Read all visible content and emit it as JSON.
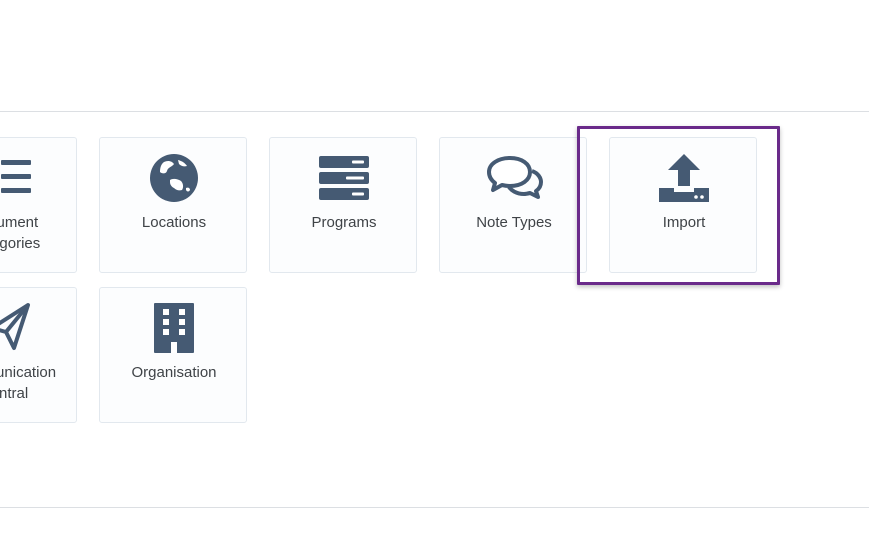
{
  "tiles": [
    {
      "id": "document-categories",
      "label": "Document\nCategories",
      "icon": "list-icon"
    },
    {
      "id": "locations",
      "label": "Locations",
      "icon": "globe-icon"
    },
    {
      "id": "programs",
      "label": "Programs",
      "icon": "server-icon"
    },
    {
      "id": "note-types",
      "label": "Note Types",
      "icon": "comments-icon"
    },
    {
      "id": "import",
      "label": "Import",
      "icon": "upload-icon"
    },
    {
      "id": "communication-central",
      "label": "Communication\nCentral",
      "icon": "paper-plane-icon"
    },
    {
      "id": "organisation",
      "label": "Organisation",
      "icon": "building-icon"
    }
  ],
  "colors": {
    "icon": "#455a73",
    "highlight_border": "#6a2a8a",
    "tile_border": "#e2e8ee",
    "divider": "#dcdfe3",
    "label": "#3f4347"
  }
}
